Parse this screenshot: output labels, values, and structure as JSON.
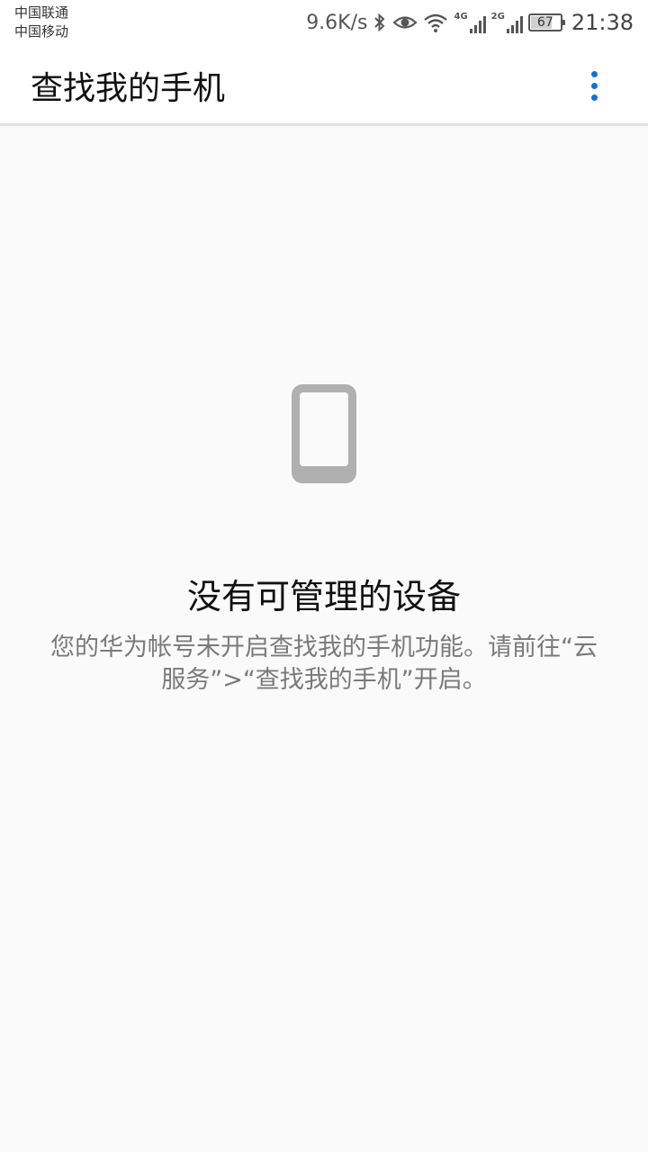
{
  "status_bar": {
    "carrier_1": "中国联通",
    "carrier_2": "中国移动",
    "net_speed": "9.6K/s",
    "signal_1_label": "4G",
    "signal_2_label": "2G",
    "battery_level": "67",
    "time": "21:38",
    "icons": [
      "bluetooth-icon",
      "eye-comfort-icon",
      "wifi-icon",
      "signal-icon",
      "battery-icon"
    ]
  },
  "app_bar": {
    "title": "查找我的手机",
    "more_icon": "more-vertical-icon",
    "accent_color": "#1a6fd1"
  },
  "empty_state": {
    "icon": "phone-icon",
    "title": "没有可管理的设备",
    "description": "您的华为帐号未开启查找我的手机功能。请前往“云服务”>“查找我的手机”开启。"
  }
}
